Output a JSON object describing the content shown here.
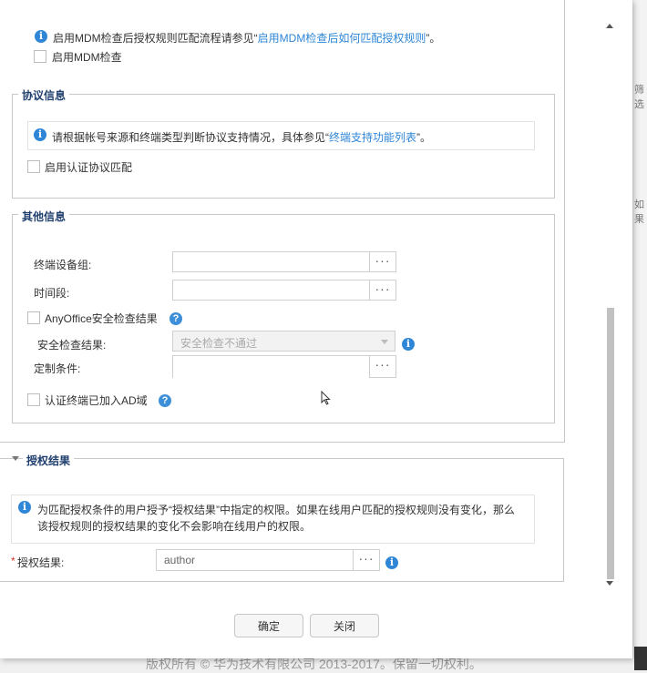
{
  "mdm": {
    "info_prefix": "启用MDM检查后授权规则匹配流程请参见“",
    "info_link": "启用MDM检查后如何匹配授权规则",
    "info_suffix": "”。",
    "checkbox_label": "启用MDM检查"
  },
  "protocol": {
    "legend": "协议信息",
    "info_prefix": "请根据帐号来源和终端类型判断协议支持情况，具体参见“",
    "info_link": "终端支持功能列表",
    "info_suffix": "”。",
    "checkbox_label": "启用认证协议匹配"
  },
  "other": {
    "legend": "其他信息",
    "device_group_label": "终端设备组:",
    "time_label": "时间段:",
    "anyoffice_label": "AnyOffice安全检查结果",
    "security_result_label": "安全检查结果:",
    "security_result_value": "安全检查不通过",
    "custom_condition_label": "定制条件:",
    "ad_domain_label": "认证终端已加入AD域"
  },
  "auth_result": {
    "legend": "授权结果",
    "info_line1": "为匹配授权条件的用户授予“授权结果”中指定的权限。如果在线用户匹配的授权规则没有变化，那么",
    "info_line2": "该授权规则的授权结果的变化不会影响在线用户的权限。",
    "required_mark": "*",
    "field_label": "授权结果:",
    "field_value": "author"
  },
  "buttons": {
    "ok": "确定",
    "close": "关闭",
    "browse": "···"
  },
  "background": {
    "frag1": "筛选",
    "frag2": "如果",
    "footer": "版权所有 © 华为技术有限公司 2013-2017。保留一切权利。"
  },
  "colors": {
    "link": "#2f86d6",
    "legend": "#1f3f6e",
    "info_icon": "#2f86d6"
  }
}
